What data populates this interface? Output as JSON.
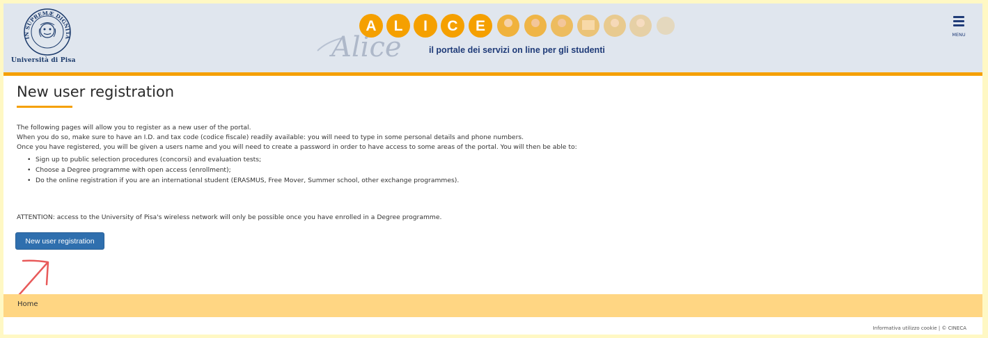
{
  "header": {
    "university_name": "Università di Pisa",
    "seal_text": "IN SUPREMÆ DIGNITATIS 1343",
    "banner_letters": [
      "A",
      "L",
      "I",
      "C",
      "E"
    ],
    "banner_script": "Alice",
    "tagline": "il portale dei servizi on line per gli studenti",
    "menu_label": "MENU"
  },
  "main": {
    "title": "New user registration",
    "intro": [
      "The following pages will allow you to register as a new user of the portal.",
      "When you do so, make sure to have an I.D. and tax code (codice fiscale) readily available: you will need to type in some personal details and phone numbers.",
      "Once you have registered, you will be given a users name and you will need to create a password in order to have access to some areas of the portal. You will then be able to:"
    ],
    "bullets": [
      "Sign up to public selection procedures (concorsi) and evaluation tests;",
      "Choose a Degree programme with open access (enrollment);",
      "Do the online registration if you are an international student (ERASMUS, Free Mover, Summer school, other exchange programmes)."
    ],
    "attention": "ATTENTION: access to the University of Pisa's wireless network will only be possible once you have enrolled in a Degree programme.",
    "register_button": "New user registration"
  },
  "breadcrumb": {
    "home": "Home"
  },
  "footer": {
    "cookie_link": "Informativa utilizzo cookie",
    "separator": "|",
    "copyright": "© CINECA"
  },
  "colors": {
    "accent": "#f5a000",
    "header_bg": "#e0e6ee",
    "breadcrumb_bg": "#ffd683",
    "button_bg": "#2f6fae",
    "navy": "#1f3b78",
    "annotation": "#e85a5a"
  },
  "icons": [
    "university-seal-icon",
    "alice-logo-icon",
    "hamburger-menu-icon",
    "annotation-arrow-icon"
  ]
}
